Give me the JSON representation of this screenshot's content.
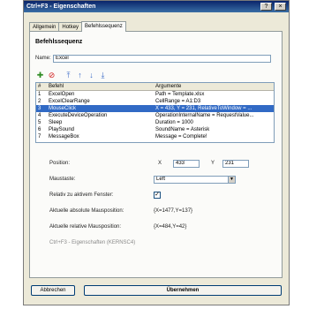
{
  "window": {
    "title": "Ctrl+F3 - Eigenschaften",
    "help_label": "?",
    "close_label": "×"
  },
  "tabs": [
    {
      "label": "Allgemein"
    },
    {
      "label": "Hotkey"
    },
    {
      "label": "Befehlssequenz"
    }
  ],
  "section": {
    "title": "Befehlssequenz"
  },
  "name": {
    "label": "Name:",
    "value": "Excel"
  },
  "toolbar": {
    "add": "✚",
    "remove": "⊘",
    "move_top": "⤒",
    "move_up": "↑",
    "move_down": "↓",
    "move_bottom": "⤓",
    "colors": {
      "add": "#2e8b22",
      "remove": "#d22020",
      "move": "#3c6cc8"
    }
  },
  "grid": {
    "headers": [
      "#",
      "Befehl",
      "Argumente"
    ],
    "rows": [
      {
        "num": "1",
        "cmd": "ExcelOpen",
        "arg": "Path = Template.xlsx"
      },
      {
        "num": "2",
        "cmd": "ExcelClearRange",
        "arg": "CellRange = A1:D3"
      },
      {
        "num": "3",
        "cmd": "MouseClick",
        "arg": "X = 433, Y = 231, RelativeToWindow = ..."
      },
      {
        "num": "4",
        "cmd": "ExecuteDeviceOperation",
        "arg": "OperationInternalName = RequestValue..."
      },
      {
        "num": "5",
        "cmd": "Sleep",
        "arg": "Duration = 1000"
      },
      {
        "num": "6",
        "cmd": "PlaySound",
        "arg": "SoundName = Asterisk"
      },
      {
        "num": "7",
        "cmd": "MessageBox",
        "arg": "Message = Complete!"
      }
    ],
    "selected_row": "3",
    "selected_color": "#316ac5"
  },
  "details": {
    "position_label": "Position:",
    "x_label": "X",
    "x_value": "433",
    "y_label": "Y",
    "y_value": "231",
    "mouse_button_label": "Maustaste:",
    "mouse_button_value": "Left",
    "relative_label": "Relativ zu aktivem Fenster:",
    "relative_checked": "✓",
    "abs_pos_label": "Aktuelle absolute Mausposition:",
    "abs_pos_value": "{X=1477,Y=137}",
    "rel_pos_label": "Aktuelle relative Mausposition:",
    "rel_pos_value": "{X=484,Y=42}",
    "footer_note": "Ctrl+F3 - Eigenschaften (KERNSC4)"
  },
  "buttons": {
    "cancel": "Abbrechen",
    "apply": "Übernehmen"
  }
}
